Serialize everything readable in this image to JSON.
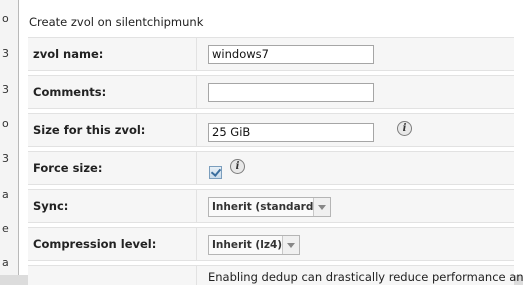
{
  "dialog": {
    "title": "Create zvol on silentchipmunk"
  },
  "background_chars": [
    "o",
    "3",
    "3",
    "o",
    "3",
    "a",
    "e",
    "a"
  ],
  "fields": {
    "zvol_name": {
      "label": "zvol name:",
      "value": "windows7"
    },
    "comments": {
      "label": "Comments:",
      "value": ""
    },
    "size": {
      "label": "Size for this zvol:",
      "value": "25 GiB"
    },
    "force_size": {
      "label": "Force size:",
      "checked": true
    },
    "sync": {
      "label": "Sync:",
      "value": "Inherit (standard)"
    },
    "compression": {
      "label": "Compression level:",
      "value": "Inherit (lz4)"
    },
    "dedup": {
      "note": "Enabling dedup can drastically reduce performance and"
    }
  },
  "icons": {
    "info": "info-icon",
    "info_glyph": "i"
  }
}
